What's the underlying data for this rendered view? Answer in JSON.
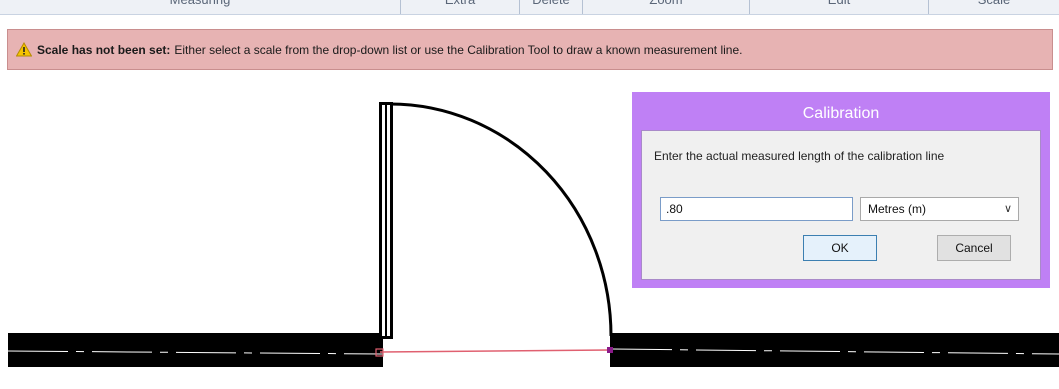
{
  "ribbon": {
    "groups": [
      "Measuring",
      "Extra",
      "Delete",
      "Zoom",
      "Edit",
      "Scale"
    ]
  },
  "warning": {
    "icon": "warning-triangle-icon",
    "title": "Scale has not been set:",
    "message": "Either select a scale from the drop-down list or use the Calibration Tool to draw a known measurement line."
  },
  "dialog": {
    "title": "Calibration",
    "prompt": "Enter the actual measured length of the calibration line",
    "length_value": ".80",
    "unit_selected": "Metres (m)",
    "ok_label": "OK",
    "cancel_label": "Cancel",
    "accent_color": "#bf80f5"
  },
  "drawing": {
    "calibration_line_color": "#e06070",
    "handle_start_color": "#e06070",
    "handle_end_color": "#8a1a8a"
  }
}
